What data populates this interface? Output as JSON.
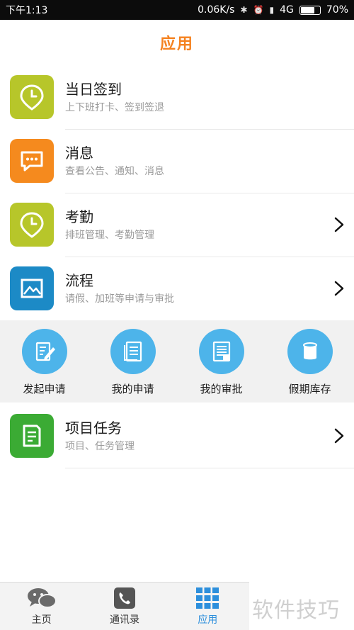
{
  "status_bar": {
    "time": "下午1:13",
    "network_speed": "0.06K/s",
    "network_type": "4G",
    "battery": "70%"
  },
  "header": {
    "title": "应用"
  },
  "rows": [
    {
      "title": "当日签到",
      "subtitle": "上下班打卡、签到签退",
      "icon": "clock-pin-icon",
      "color": "#b7c62a",
      "arrow": false
    },
    {
      "title": "消息",
      "subtitle": "查看公告、通知、消息",
      "icon": "chat-bubble-icon",
      "color": "#f58a1e",
      "arrow": false
    },
    {
      "title": "考勤",
      "subtitle": "排班管理、考勤管理",
      "icon": "clock-pin-icon",
      "color": "#b7c62a",
      "arrow": true
    },
    {
      "title": "流程",
      "subtitle": "请假、加班等申请与审批",
      "icon": "picture-icon",
      "color": "#1c8ac6",
      "arrow": true
    }
  ],
  "quick_actions": [
    {
      "label": "发起申请",
      "icon": "edit-form-icon"
    },
    {
      "label": "我的申请",
      "icon": "document-list-icon"
    },
    {
      "label": "我的审批",
      "icon": "review-doc-icon"
    },
    {
      "label": "假期库存",
      "icon": "cylinder-icon"
    }
  ],
  "project_row": {
    "title": "项目任务",
    "subtitle": "项目、任务管理",
    "icon": "task-doc-icon",
    "color": "#3bab34",
    "arrow": true
  },
  "bottom_nav": [
    {
      "label": "主页",
      "icon": "wechat-chat-icon",
      "active": false
    },
    {
      "label": "通讯录",
      "icon": "phone-icon",
      "active": false
    },
    {
      "label": "应用",
      "icon": "grid-icon",
      "active": true
    }
  ],
  "watermark": "软件技巧",
  "colors": {
    "accent": "#f58220",
    "active_nav": "#2d8fdc",
    "quick_circle": "#4db4ea"
  }
}
